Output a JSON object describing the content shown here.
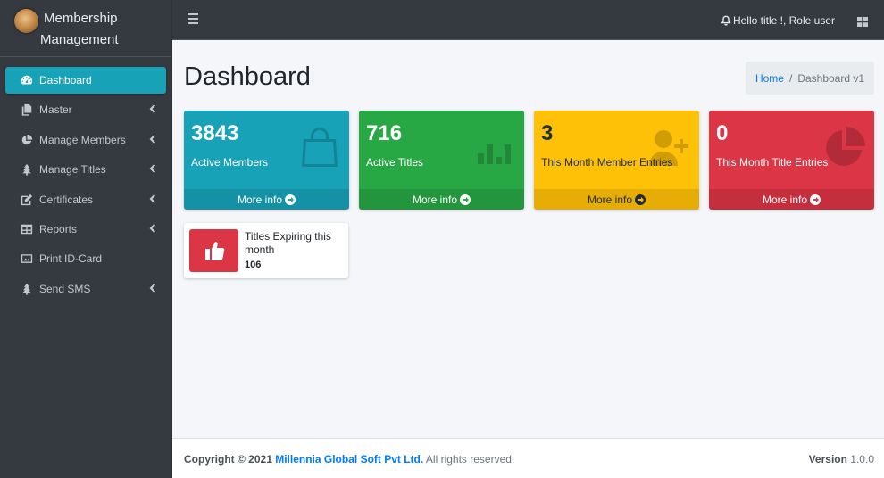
{
  "brand": {
    "line1": "Membership",
    "line2": "Management"
  },
  "sidebar": {
    "items": [
      {
        "label": "Dashboard",
        "icon": "tachometer-icon",
        "active": true
      },
      {
        "label": "Master",
        "icon": "copy-icon"
      },
      {
        "label": "Manage Members",
        "icon": "pie-chart-icon"
      },
      {
        "label": "Manage Titles",
        "icon": "tree-icon"
      },
      {
        "label": "Certificates",
        "icon": "edit-icon"
      },
      {
        "label": "Reports",
        "icon": "table-icon"
      },
      {
        "label": "Print ID-Card",
        "icon": "image-icon"
      },
      {
        "label": "Send SMS",
        "icon": "tree-icon"
      }
    ]
  },
  "topbar": {
    "greeting": "Hello title !, Role user"
  },
  "header": {
    "title": "Dashboard",
    "breadcrumb_home": "Home",
    "breadcrumb_sep": "/",
    "breadcrumb_current": "Dashboard v1"
  },
  "boxes": [
    {
      "value": "3843",
      "label": "Active Members",
      "more": "More info",
      "color": "#17a2b8",
      "icon": "shopping-bag-icon"
    },
    {
      "value": "716",
      "label": "Active Titles",
      "more": "More info",
      "color": "#28a745",
      "icon": "bar-chart-icon"
    },
    {
      "value": "3",
      "label": "This Month Member Entries",
      "more": "More info",
      "color": "#ffc107",
      "icon": "user-plus-icon"
    },
    {
      "value": "0",
      "label": "This Month Title Entries",
      "more": "More info",
      "color": "#dc3545",
      "icon": "pie-chart-icon"
    }
  ],
  "info_box": {
    "text": "Titles Expiring this month",
    "value": "106",
    "icon": "thumbs-up-icon"
  },
  "footer": {
    "copyright_prefix": "Copyright © 2021",
    "company": "Millennia Global Soft Pvt Ltd.",
    "suffix": "All rights reserved.",
    "version_label": "Version",
    "version_value": "1.0.0"
  }
}
